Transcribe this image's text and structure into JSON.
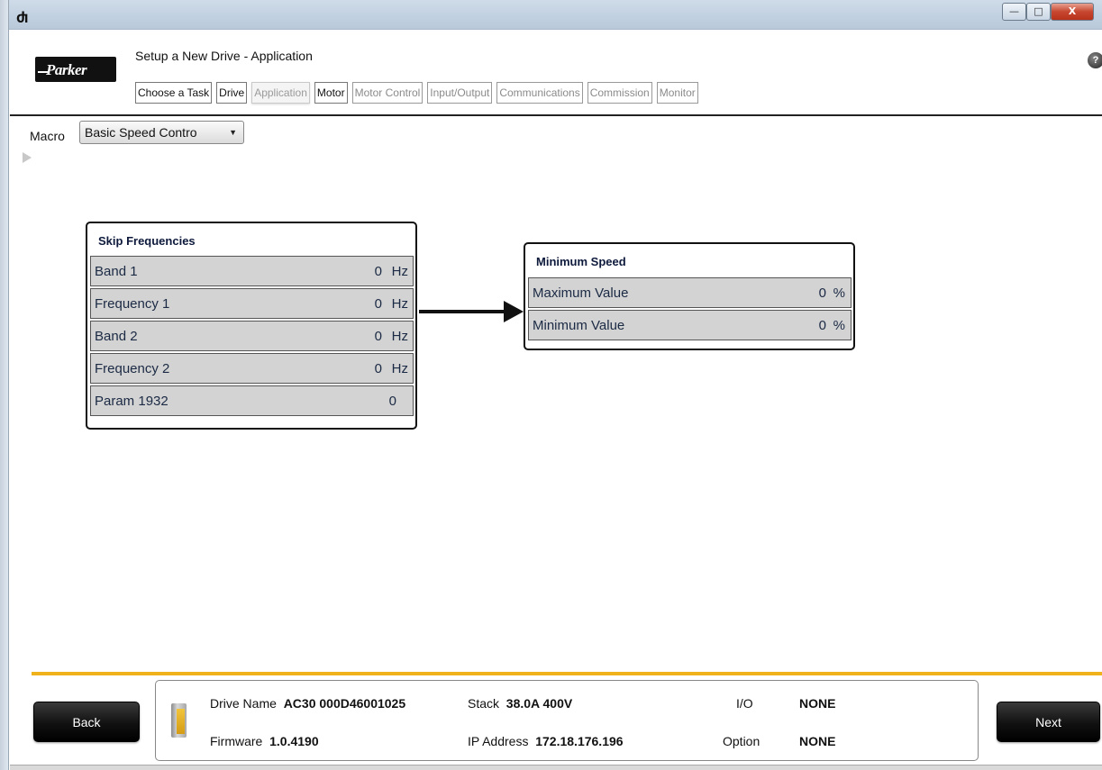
{
  "window": {
    "app_icon": "Ⴛ",
    "minimize": "—",
    "maximize": "□",
    "close": "X"
  },
  "header": {
    "logo_text": "Parker",
    "title": "Setup a New Drive - Application",
    "help": "?"
  },
  "tabs": [
    {
      "label": "Choose a Task",
      "state": "normal"
    },
    {
      "label": "Drive",
      "state": "normal"
    },
    {
      "label": "Application",
      "state": "active"
    },
    {
      "label": "Motor",
      "state": "normal"
    },
    {
      "label": "Motor Control",
      "state": "dim"
    },
    {
      "label": "Input/Output",
      "state": "dim"
    },
    {
      "label": "Communications",
      "state": "dim"
    },
    {
      "label": "Commission",
      "state": "dim"
    },
    {
      "label": "Monitor",
      "state": "dim"
    }
  ],
  "macro": {
    "label": "Macro",
    "selected": "Basic Speed Contro"
  },
  "skip_frequencies": {
    "title": "Skip Frequencies",
    "rows": [
      {
        "label": "Band 1",
        "value": "0",
        "unit": "Hz"
      },
      {
        "label": "Frequency 1",
        "value": "0",
        "unit": "Hz"
      },
      {
        "label": "Band 2",
        "value": "0",
        "unit": "Hz"
      },
      {
        "label": "Frequency 2",
        "value": "0",
        "unit": "Hz"
      },
      {
        "label": "Param 1932",
        "value": "0",
        "unit": ""
      }
    ]
  },
  "minimum_speed": {
    "title": "Minimum Speed",
    "rows": [
      {
        "label": "Maximum Value",
        "value": "0",
        "unit": "%"
      },
      {
        "label": "Minimum Value",
        "value": "0",
        "unit": "%"
      }
    ]
  },
  "footer": {
    "back_label": "Back",
    "next_label": "Next",
    "drive_name_label": "Drive Name",
    "drive_name_value": "AC30 000D46001025",
    "firmware_label": "Firmware",
    "firmware_value": "1.0.4190",
    "stack_label": "Stack",
    "stack_value": "38.0A 400V",
    "ip_label": "IP Address",
    "ip_value": "172.18.176.196",
    "io_label": "I/O",
    "io_value": "NONE",
    "option_label": "Option",
    "option_value": "NONE"
  },
  "colors": {
    "accent_rule": "#f0b21a",
    "row_bg": "#d3d3d3",
    "card_title": "#0e1a3c"
  }
}
